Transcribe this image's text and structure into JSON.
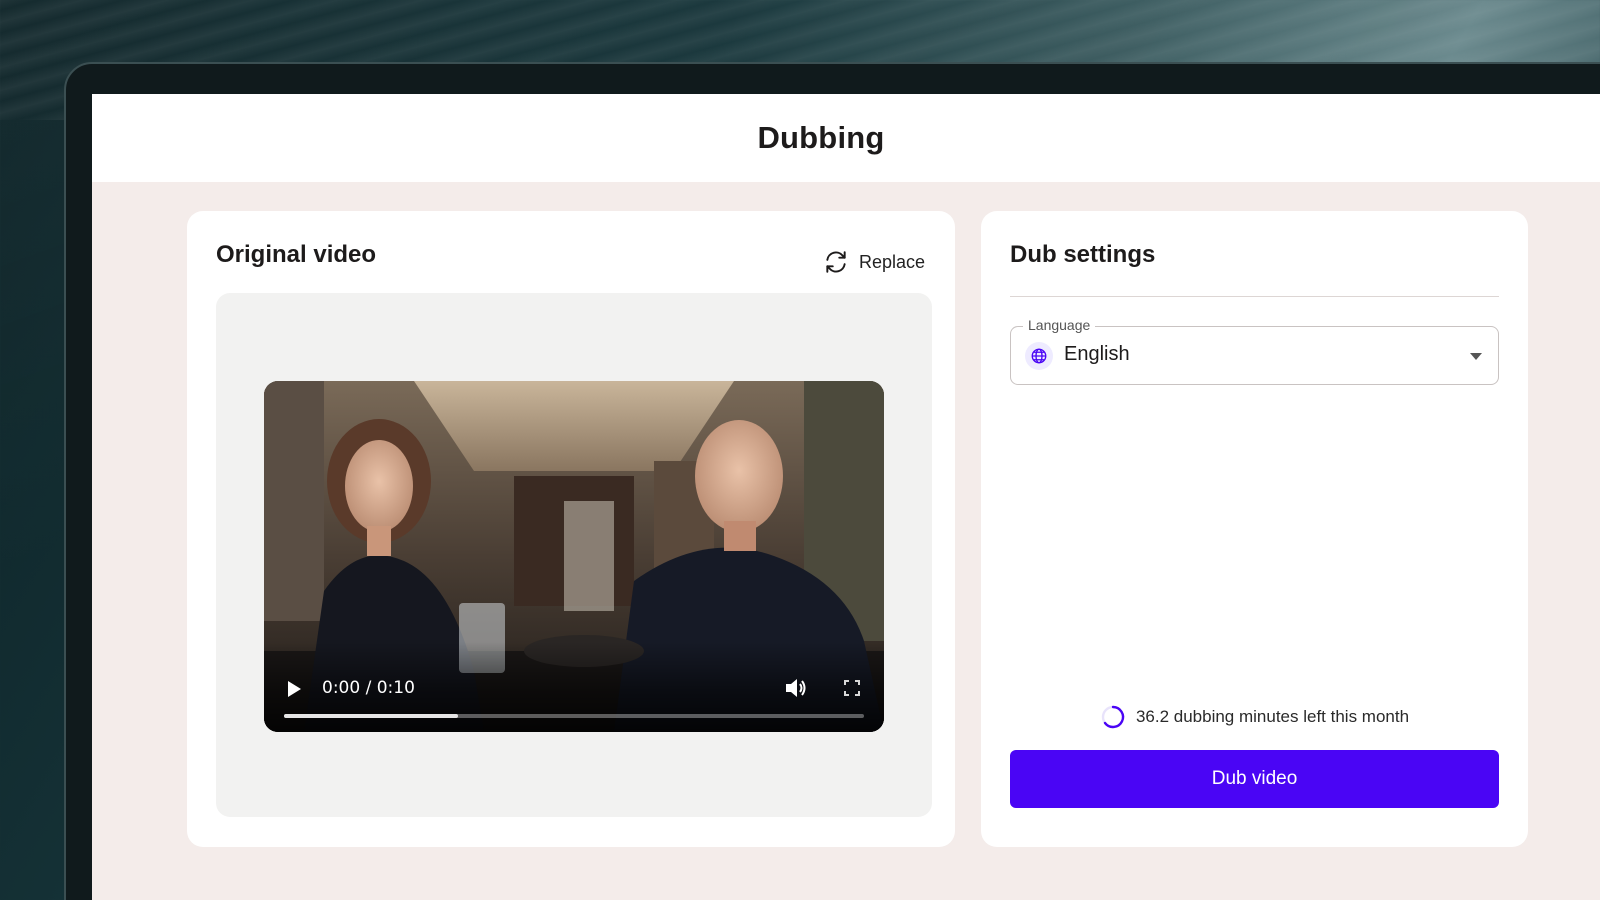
{
  "app": {
    "title": "Dubbing"
  },
  "original_video": {
    "title": "Original video",
    "replace_label": "Replace",
    "player": {
      "time": "0:00 / 0:10",
      "progress_fraction": 0.3
    }
  },
  "dub_settings": {
    "title": "Dub settings",
    "language": {
      "label": "Language",
      "value": "English"
    },
    "minutes_text": "36.2 dubbing minutes left this month",
    "dub_button_label": "Dub video"
  },
  "colors": {
    "accent": "#4a05f5",
    "page_background": "#f4ecea"
  },
  "icons": [
    "replace-icon",
    "play-icon",
    "volume-icon",
    "fullscreen-icon",
    "globe-icon",
    "chevron-down-icon",
    "spinner-icon"
  ]
}
